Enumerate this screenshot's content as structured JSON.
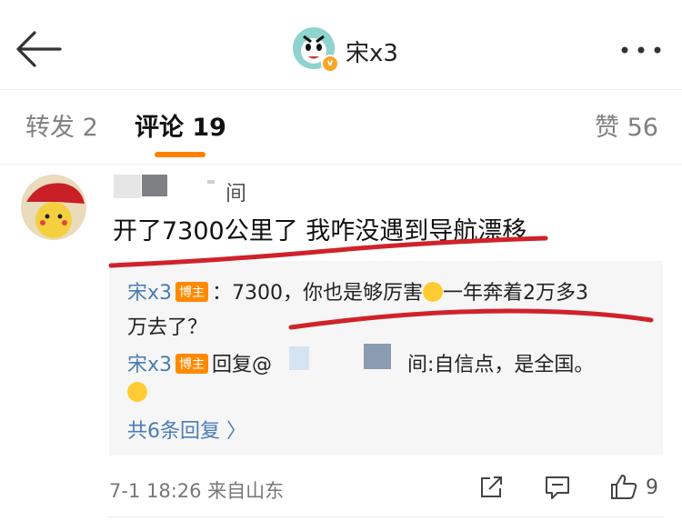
{
  "header": {
    "username": "宋x3"
  },
  "tabs": {
    "repost_label": "转发 2",
    "comment_label": "评论 19",
    "likes_label": "赞 56"
  },
  "comment": {
    "name_suffix": "间",
    "text": "开了7300公里了 我咋没遇到导航漂移",
    "footer_meta": "7-1 18:26  来自山东",
    "like_count": "9"
  },
  "replies": [
    {
      "author": "宋x3",
      "badge": "博主",
      "text_before_emoji": "：7300，你也是够厉害",
      "text_after_emoji": "一年奔着2万多3",
      "text_line2": "万去了？"
    },
    {
      "author": "宋x3",
      "badge": "博主",
      "prefix": "回复@",
      "text": "间:自信点，是全国。"
    }
  ],
  "more_replies_label": "共6条回复 〉",
  "icons": {
    "back": "back-arrow-icon",
    "more": "more-dots-icon",
    "share": "share-icon",
    "comment": "comment-icon",
    "like": "thumbs-up-icon"
  },
  "colors": {
    "accent_orange": "#ff8200",
    "link_blue": "#4a7cb4",
    "annotation_red": "#d0222a"
  }
}
